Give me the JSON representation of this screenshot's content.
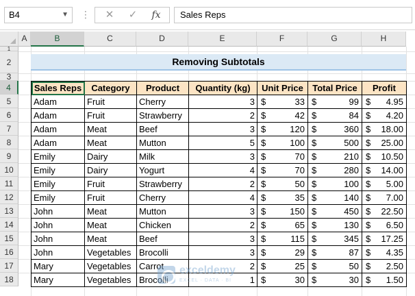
{
  "formula_bar": {
    "name_box": "B4",
    "cancel_symbol": "✕",
    "enter_symbol": "✓",
    "fx_symbol": "fx",
    "formula": "Sales Reps"
  },
  "columns": [
    "A",
    "B",
    "C",
    "D",
    "E",
    "F",
    "G",
    "H"
  ],
  "rows": [
    "1",
    "2",
    "3",
    "4",
    "5",
    "6",
    "7",
    "8",
    "9",
    "10",
    "11",
    "12",
    "13",
    "14",
    "15",
    "16",
    "17",
    "18"
  ],
  "title": "Removing Subtotals",
  "table": {
    "headers": [
      "Sales Reps",
      "Category",
      "Product",
      "Quantity (kg)",
      "Unit Price",
      "Total Price",
      "Profit"
    ],
    "currency": "$",
    "rows": [
      [
        "Adam",
        "Fruit",
        "Cherry",
        "3",
        "33",
        "99",
        "4.95"
      ],
      [
        "Adam",
        "Fruit",
        "Strawberry",
        "2",
        "42",
        "84",
        "4.20"
      ],
      [
        "Adam",
        "Meat",
        "Beef",
        "3",
        "120",
        "360",
        "18.00"
      ],
      [
        "Adam",
        "Meat",
        "Mutton",
        "5",
        "100",
        "500",
        "25.00"
      ],
      [
        "Emily",
        "Dairy",
        "Milk",
        "3",
        "70",
        "210",
        "10.50"
      ],
      [
        "Emily",
        "Dairy",
        "Yogurt",
        "4",
        "70",
        "280",
        "14.00"
      ],
      [
        "Emily",
        "Fruit",
        "Strawberry",
        "2",
        "50",
        "100",
        "5.00"
      ],
      [
        "Emily",
        "Fruit",
        "Cherry",
        "4",
        "35",
        "140",
        "7.00"
      ],
      [
        "John",
        "Meat",
        "Mutton",
        "3",
        "150",
        "450",
        "22.50"
      ],
      [
        "John",
        "Meat",
        "Chicken",
        "2",
        "65",
        "130",
        "6.50"
      ],
      [
        "John",
        "Meat",
        "Beef",
        "3",
        "115",
        "345",
        "17.25"
      ],
      [
        "John",
        "Vegetables",
        "Brocolli",
        "3",
        "29",
        "87",
        "4.35"
      ],
      [
        "Mary",
        "Vegetables",
        "Carrot",
        "2",
        "25",
        "50",
        "2.50"
      ],
      [
        "Mary",
        "Vegetables",
        "Brocolli",
        "1",
        "30",
        "30",
        "1.50"
      ]
    ]
  },
  "watermark": {
    "name": "exceldemy",
    "tagline": "EXCEL · DATA · BI"
  },
  "colors": {
    "title_fill": "#dbe9f5",
    "header_fill": "#fce4c4",
    "selection": "#217346"
  }
}
